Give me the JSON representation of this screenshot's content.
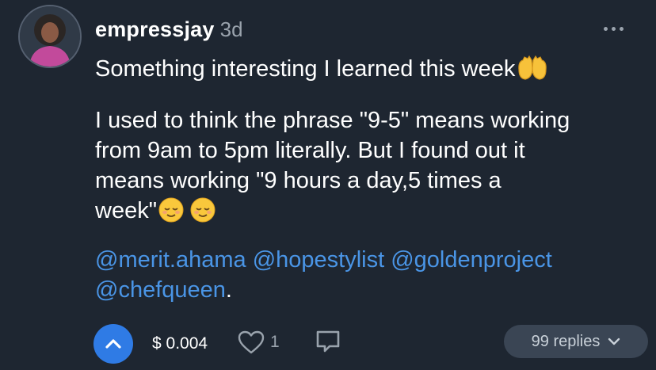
{
  "post": {
    "username": "empressjay",
    "time": "3d",
    "headline": "Something interesting I learned this week",
    "headline_emoji": "raising-hands-emoji",
    "body_lines": [
      "I used to think the phrase \"9-5\" means working",
      "from 9am to 5pm literally. But I found out it",
      "means working \"9 hours a day,5 times a",
      "week\""
    ],
    "body_emoji": [
      "relieved-face-emoji",
      "relieved-face-emoji"
    ],
    "mentions": [
      "@merit.ahama",
      "@hopestylist",
      "@goldenproject",
      "@chefqueen"
    ],
    "mentions_suffix": "."
  },
  "actions": {
    "amount": "$ 0.004",
    "likes": "1",
    "replies_label": "99 replies"
  },
  "colors": {
    "background": "#1e2631",
    "accent": "#2f7be5",
    "mention": "#4a95e6",
    "muted": "#9aa3ad",
    "pill": "#3a4554"
  },
  "icons": [
    "more-icon",
    "upvote-icon",
    "heart-icon",
    "comment-icon",
    "chevron-down-icon"
  ]
}
